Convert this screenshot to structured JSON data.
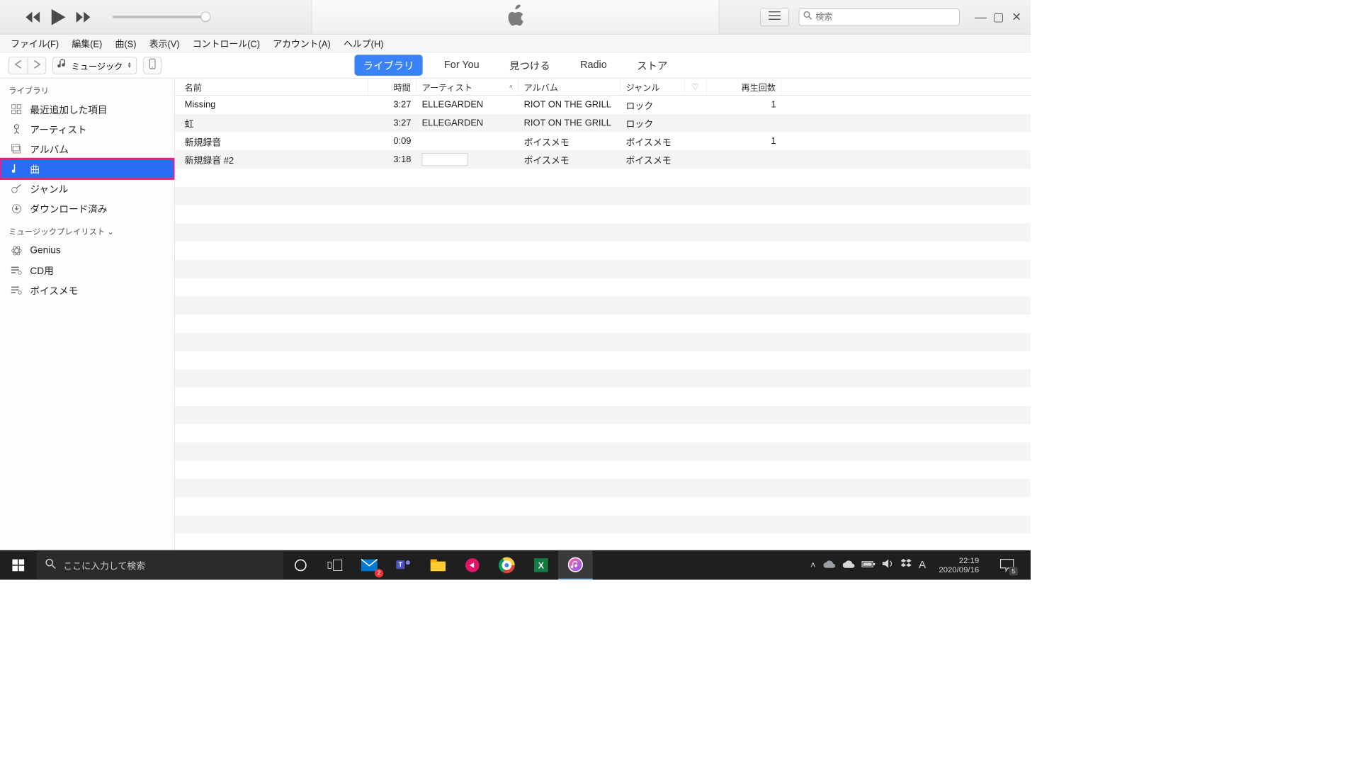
{
  "menu": {
    "file": "ファイル(F)",
    "edit": "編集(E)",
    "song": "曲(S)",
    "view": "表示(V)",
    "controls": "コントロール(C)",
    "account": "アカウント(A)",
    "help": "ヘルプ(H)"
  },
  "toolbar": {
    "media_selector": "ミュージック",
    "tabs": {
      "library": "ライブラリ",
      "for_you": "For You",
      "browse": "見つける",
      "radio": "Radio",
      "store": "ストア"
    }
  },
  "search": {
    "placeholder": "検索"
  },
  "sidebar": {
    "library_header": "ライブラリ",
    "items": {
      "recent": "最近追加した項目",
      "artists": "アーティスト",
      "albums": "アルバム",
      "songs": "曲",
      "genres": "ジャンル",
      "downloaded": "ダウンロード済み"
    },
    "playlists_header": "ミュージックプレイリスト",
    "playlists": {
      "genius": "Genius",
      "cd": "CD用",
      "voice": "ボイスメモ"
    }
  },
  "columns": {
    "name": "名前",
    "time": "時間",
    "artist": "アーティスト",
    "album": "アルバム",
    "genre": "ジャンル",
    "plays": "再生回数"
  },
  "tracks": [
    {
      "name": "Missing",
      "time": "3:27",
      "artist": "ELLEGARDEN",
      "album": "RIOT ON THE GRILL",
      "genre": "ロック",
      "plays": "1"
    },
    {
      "name": "虹",
      "time": "3:27",
      "artist": "ELLEGARDEN",
      "album": "RIOT ON THE GRILL",
      "genre": "ロック",
      "plays": ""
    },
    {
      "name": "新規録音",
      "time": "0:09",
      "artist": "",
      "album": "ボイスメモ",
      "genre": "ボイスメモ",
      "plays": "1"
    },
    {
      "name": "新規録音 #2",
      "time": "3:18",
      "artist": "",
      "album": "ボイスメモ",
      "genre": "ボイスメモ",
      "plays": ""
    }
  ],
  "taskbar": {
    "search_placeholder": "ここに入力して検索",
    "time": "22:19",
    "date": "2020/09/16",
    "notif_count": "5",
    "mail_badge": "2",
    "ime": "A"
  }
}
